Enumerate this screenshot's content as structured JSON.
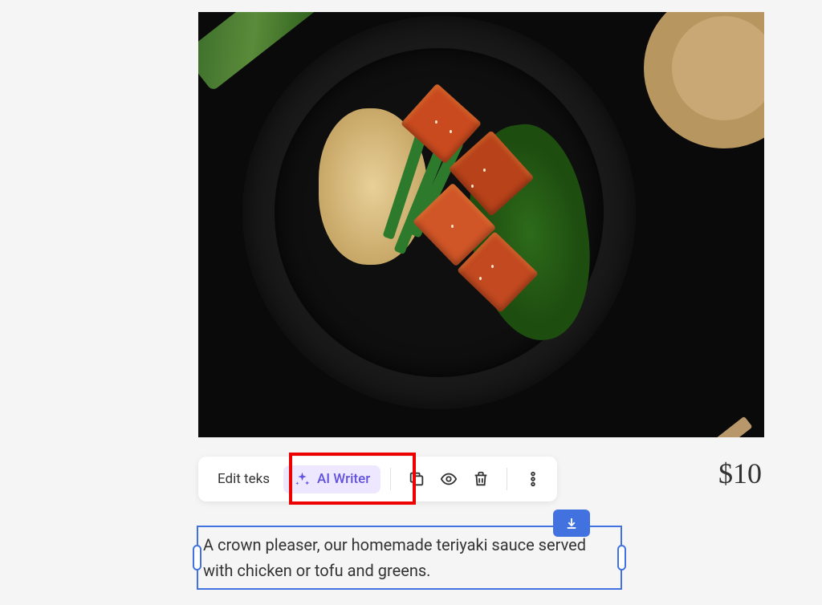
{
  "toolbar": {
    "edit_text_label": "Edit teks",
    "ai_writer_label": "AI Writer"
  },
  "price": "$10",
  "description": "A crown pleaser, our homemade teriyaki sauce served with chicken or tofu and greens.",
  "icons": {
    "sparkle": "sparkle-icon",
    "copy": "copy-icon",
    "eye": "eye-icon",
    "trash": "trash-icon",
    "more": "more-vertical-icon",
    "download": "download-icon"
  },
  "colors": {
    "highlight": "#ed0000",
    "selection": "#4272e0",
    "ai_accent": "#6153e0",
    "ai_bg": "#ede8ff"
  }
}
